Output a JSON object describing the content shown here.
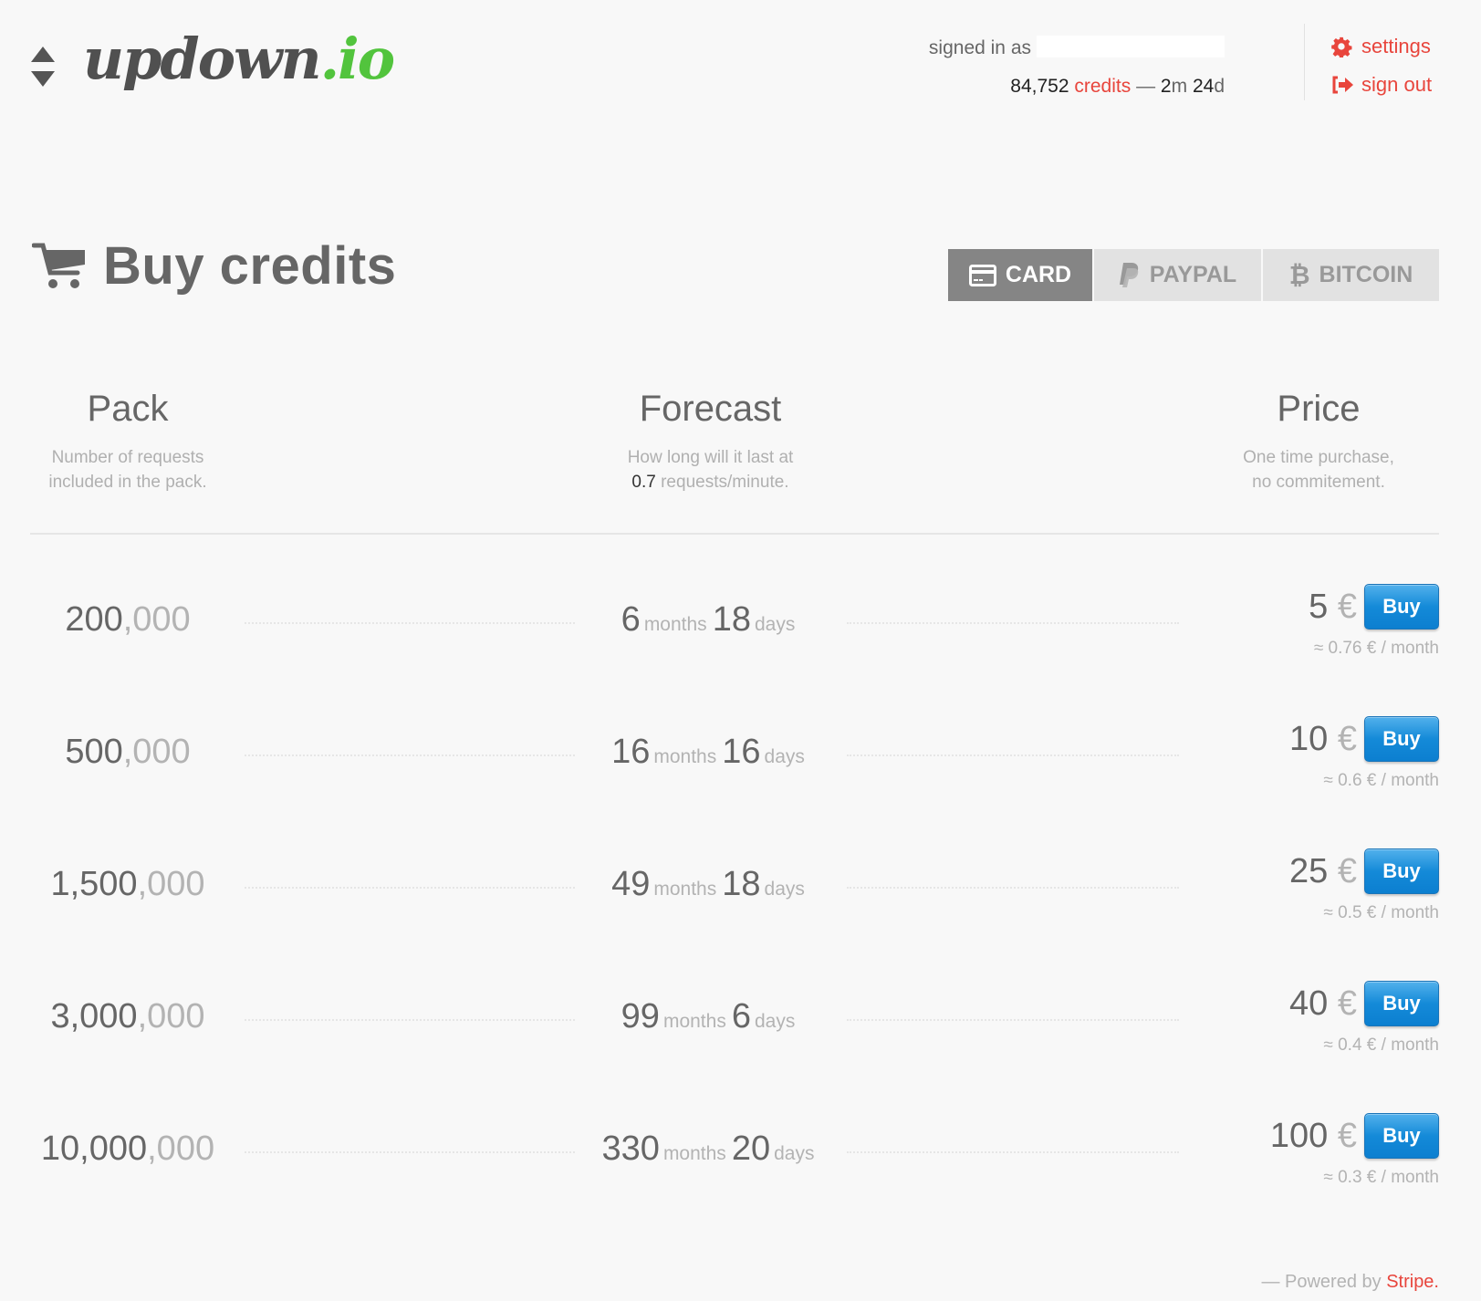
{
  "header": {
    "logo_main": "updown",
    "logo_tld": ".io",
    "signed_in_label": "signed in as",
    "credits_count": "84,752",
    "credits_label": "credits",
    "separator": "—",
    "remaining_months": "2",
    "remaining_months_unit": "m",
    "remaining_days": "24",
    "remaining_days_unit": "d",
    "settings_label": "settings",
    "signout_label": "sign out"
  },
  "page": {
    "title": "Buy credits"
  },
  "payment_tabs": [
    {
      "label": "CARD",
      "icon": "credit-card-icon",
      "active": true
    },
    {
      "label": "PAYPAL",
      "icon": "paypal-icon",
      "active": false
    },
    {
      "label": "BITCOIN",
      "icon": "bitcoin-icon",
      "active": false
    }
  ],
  "columns": {
    "pack": {
      "title": "Pack",
      "line1": "Number of requests",
      "line2": "included in the pack."
    },
    "forecast": {
      "title": "Forecast",
      "line1": "How long will it last at",
      "rate": "0.7",
      "line2_rest": "requests/minute."
    },
    "price": {
      "title": "Price",
      "line1": "One time purchase,",
      "line2": "no commitement."
    }
  },
  "units": {
    "months": "months",
    "days": "days",
    "currency": "€",
    "buy": "Buy"
  },
  "packs": [
    {
      "pack_main": "200",
      "pack_zeros": ",000",
      "months": "6",
      "days": "18",
      "price": "5",
      "monthly": "≈ 0.76 € / month"
    },
    {
      "pack_main": "500",
      "pack_zeros": ",000",
      "months": "16",
      "days": "16",
      "price": "10",
      "monthly": "≈ 0.6 € / month"
    },
    {
      "pack_main": "1,500",
      "pack_zeros": ",000",
      "months": "49",
      "days": "18",
      "price": "25",
      "monthly": "≈ 0.5 € / month"
    },
    {
      "pack_main": "3,000",
      "pack_zeros": ",000",
      "months": "99",
      "days": "6",
      "price": "40",
      "monthly": "≈ 0.4 € / month"
    },
    {
      "pack_main": "10,000",
      "pack_zeros": ",000",
      "months": "330",
      "days": "20",
      "price": "100",
      "monthly": "≈ 0.3 € / month"
    }
  ],
  "footer": {
    "prefix": "— Powered by",
    "brand": "Stripe."
  },
  "colors": {
    "accent_red": "#e8453c",
    "logo_green": "#52c43d",
    "buy_blue": "#148ad8"
  }
}
